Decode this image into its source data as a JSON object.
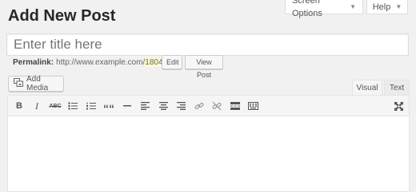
{
  "header": {
    "title": "Add New Post",
    "screen_options": "Screen Options",
    "help": "Help"
  },
  "post": {
    "title_placeholder": "Enter title here"
  },
  "permalink": {
    "label": "Permalink:",
    "base_url": "http://www.example.com/",
    "slug": "1804",
    "suffix": "/",
    "edit_label": "Edit",
    "view_label": "View Post"
  },
  "media": {
    "add_media_label": "Add Media"
  },
  "editor_tabs": {
    "visual": "Visual",
    "text": "Text"
  },
  "toolbar": {
    "icons": [
      "bold-icon",
      "italic-icon",
      "strikethrough-icon",
      "bullet-list-icon",
      "numbered-list-icon",
      "blockquote-icon",
      "horizontal-rule-icon",
      "align-left-icon",
      "align-center-icon",
      "align-right-icon",
      "insert-link-icon",
      "remove-link-icon",
      "read-more-icon",
      "toolbar-toggle-icon",
      "fullscreen-icon"
    ],
    "bold_glyph": "B",
    "italic_glyph": "I",
    "strike_glyph": "ABC",
    "quote_glyph": "““"
  }
}
